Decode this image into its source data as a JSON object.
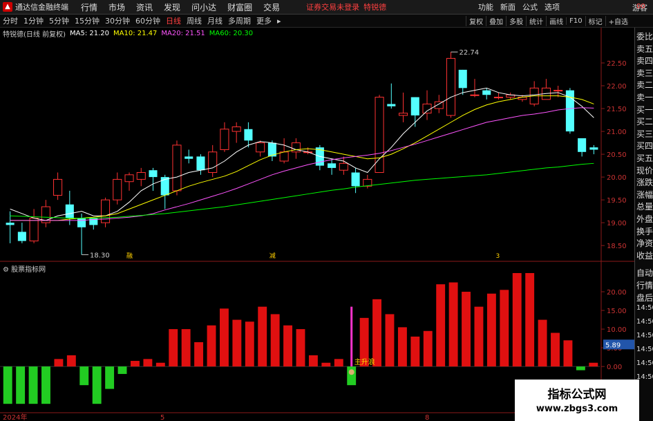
{
  "app": {
    "title": "通达信金融终端",
    "menu": [
      "行情",
      "市场",
      "资讯",
      "发现",
      "问小达",
      "财富圈",
      "交易"
    ],
    "alert": "证券交易未登录",
    "alert2": "特锐德",
    "right_menu": [
      "功能",
      "新面",
      "公式",
      "选项"
    ],
    "guest": "游客"
  },
  "period_tabs": {
    "items": [
      "分时",
      "1分钟",
      "5分钟",
      "15分钟",
      "30分钟",
      "60分钟",
      "日线",
      "周线",
      "月线",
      "多周期",
      "更多"
    ],
    "active_index": 6
  },
  "tools": [
    "复权",
    "叠加",
    "多股",
    "统计",
    "画线",
    "F10",
    "标记",
    "+自选"
  ],
  "legend": {
    "stock": "特锐德(日线 前复权)",
    "ma5": "MA5: 21.20",
    "ma10": "MA10: 21.47",
    "ma20": "MA20: 21.51",
    "ma60": "MA60: 20.30",
    "colors": {
      "ma5": "#ffffff",
      "ma10": "#ffff00",
      "ma20": "#ff55ff",
      "ma60": "#00ff00"
    }
  },
  "side_labels": {
    "top": [
      "委比",
      "卖五",
      "卖四",
      "卖三",
      "卖二",
      "卖一",
      "买一",
      "买二",
      "买三",
      "买四",
      "买五",
      "现价",
      "涨跌",
      "涨幅",
      "总量",
      "外盘",
      "换手",
      "净资",
      "收益"
    ],
    "bottom": [
      "自动",
      "行情",
      "盘后"
    ],
    "times": [
      "14:50",
      "14:50",
      "14:50",
      "14:50",
      "14:50",
      "14:50"
    ],
    "sidebar_num": "00"
  },
  "indicator": {
    "title": "股票指标网",
    "annotation": "主升浪",
    "value_badge": "5.89"
  },
  "chart_data": [
    {
      "type": "candlestick",
      "yticks": [
        "22.50",
        "22.00",
        "21.50",
        "21.00",
        "20.50",
        "20.00",
        "19.50",
        "19.00",
        "18.50"
      ],
      "ylim": [
        18.2,
        23.0
      ],
      "high_label": "22.74",
      "low_label": "18.30",
      "event_markers": [
        "融",
        "减",
        "3"
      ],
      "candles": [
        [
          19.0,
          18.95,
          19.25,
          18.55
        ],
        [
          18.8,
          18.6,
          19.0,
          18.55
        ],
        [
          18.6,
          19.1,
          19.3,
          18.55
        ],
        [
          19.0,
          19.35,
          19.5,
          18.9
        ],
        [
          19.6,
          19.95,
          20.1,
          19.5
        ],
        [
          19.4,
          19.1,
          19.7,
          18.95
        ],
        [
          19.1,
          18.9,
          19.2,
          18.3
        ],
        [
          19.1,
          18.95,
          19.1,
          18.85
        ],
        [
          19.0,
          19.5,
          19.55,
          18.9
        ],
        [
          19.5,
          19.95,
          20.1,
          19.4
        ],
        [
          19.9,
          20.05,
          20.1,
          19.7
        ],
        [
          19.95,
          20.1,
          20.2,
          19.8
        ],
        [
          20.15,
          20.0,
          20.2,
          19.7
        ],
        [
          20.0,
          19.6,
          20.05,
          19.3
        ],
        [
          19.7,
          20.7,
          20.8,
          19.6
        ],
        [
          20.45,
          20.4,
          20.6,
          20.3
        ],
        [
          20.45,
          20.15,
          20.5,
          20.05
        ],
        [
          20.1,
          20.55,
          20.7,
          20.0
        ],
        [
          20.6,
          21.05,
          21.2,
          20.55
        ],
        [
          21.0,
          21.1,
          21.2,
          20.75
        ],
        [
          21.05,
          20.8,
          21.2,
          20.65
        ],
        [
          20.55,
          20.75,
          20.8,
          20.45
        ],
        [
          20.75,
          20.45,
          20.8,
          20.35
        ],
        [
          20.35,
          20.55,
          20.85,
          20.3
        ],
        [
          20.55,
          20.75,
          20.85,
          20.4
        ],
        [
          20.55,
          20.55,
          20.65,
          20.5
        ],
        [
          20.65,
          20.25,
          20.7,
          20.15
        ],
        [
          20.3,
          20.2,
          20.4,
          20.05
        ],
        [
          20.15,
          20.3,
          20.45,
          20.05
        ],
        [
          20.1,
          19.8,
          20.2,
          19.65
        ],
        [
          19.8,
          19.95,
          20.05,
          19.75
        ],
        [
          20.1,
          21.75,
          21.8,
          20.1
        ],
        [
          21.6,
          21.55,
          22.05,
          21.5
        ],
        [
          21.35,
          21.4,
          21.85,
          21.2
        ],
        [
          21.75,
          21.35,
          21.75,
          21.1
        ],
        [
          21.4,
          21.6,
          21.9,
          21.25
        ],
        [
          21.5,
          21.65,
          21.8,
          21.4
        ],
        [
          21.35,
          22.6,
          22.74,
          21.3
        ],
        [
          22.35,
          21.95,
          22.35,
          21.8
        ],
        [
          21.8,
          21.8,
          22.15,
          21.75
        ],
        [
          21.9,
          21.8,
          21.95,
          21.7
        ],
        [
          21.75,
          21.75,
          21.85,
          21.7
        ],
        [
          21.75,
          21.8,
          21.85,
          21.7
        ],
        [
          21.7,
          21.75,
          21.8,
          21.65
        ],
        [
          21.6,
          21.95,
          22.1,
          21.55
        ],
        [
          21.7,
          21.95,
          22.15,
          21.7
        ],
        [
          21.9,
          21.9,
          22.0,
          21.75
        ],
        [
          21.9,
          21.0,
          21.95,
          20.95
        ],
        [
          20.85,
          20.55,
          20.85,
          20.45
        ],
        [
          20.65,
          20.6,
          20.7,
          20.5
        ]
      ],
      "ma": {
        "MA5": [
          19.3,
          19.2,
          19.1,
          19.05,
          19.15,
          19.2,
          19.25,
          19.15,
          19.15,
          19.25,
          19.45,
          19.7,
          19.85,
          19.95,
          20.0,
          20.1,
          20.15,
          20.2,
          20.35,
          20.55,
          20.7,
          20.78,
          20.75,
          20.7,
          20.6,
          20.55,
          20.45,
          20.4,
          20.35,
          20.2,
          20.1,
          20.4,
          20.65,
          20.95,
          21.2,
          21.45,
          21.6,
          21.75,
          21.85,
          21.9,
          21.95,
          21.85,
          21.8,
          21.78,
          21.8,
          21.83,
          21.85,
          21.75,
          21.55,
          21.3
        ],
        "MA10": [
          19.05,
          19.05,
          19.05,
          19.05,
          19.05,
          19.08,
          19.1,
          19.12,
          19.15,
          19.2,
          19.3,
          19.4,
          19.5,
          19.6,
          19.7,
          19.8,
          19.88,
          19.95,
          20.02,
          20.12,
          20.25,
          20.38,
          20.48,
          20.55,
          20.6,
          20.62,
          20.6,
          20.55,
          20.5,
          20.45,
          20.4,
          20.42,
          20.5,
          20.62,
          20.75,
          20.9,
          21.05,
          21.2,
          21.35,
          21.48,
          21.58,
          21.65,
          21.7,
          21.75,
          21.78,
          21.78,
          21.78,
          21.75,
          21.7,
          21.6
        ],
        "MA20": [
          19.05,
          19.05,
          19.05,
          19.05,
          19.05,
          19.05,
          19.05,
          19.07,
          19.08,
          19.1,
          19.12,
          19.15,
          19.2,
          19.28,
          19.35,
          19.42,
          19.5,
          19.58,
          19.66,
          19.75,
          19.85,
          19.95,
          20.05,
          20.13,
          20.2,
          20.27,
          20.33,
          20.38,
          20.42,
          20.45,
          20.48,
          20.52,
          20.58,
          20.65,
          20.72,
          20.8,
          20.88,
          20.96,
          21.04,
          21.12,
          21.2,
          21.25,
          21.3,
          21.35,
          21.38,
          21.42,
          21.47,
          21.5,
          21.52,
          21.51
        ],
        "MA60": [
          19.15,
          19.14,
          19.13,
          19.12,
          19.11,
          19.1,
          19.1,
          19.1,
          19.11,
          19.12,
          19.14,
          19.16,
          19.18,
          19.2,
          19.23,
          19.26,
          19.29,
          19.32,
          19.35,
          19.39,
          19.43,
          19.47,
          19.51,
          19.55,
          19.59,
          19.63,
          19.67,
          19.71,
          19.74,
          19.78,
          19.81,
          19.84,
          19.87,
          19.9,
          19.93,
          19.95,
          19.97,
          19.99,
          20.01,
          20.03,
          20.05,
          20.08,
          20.11,
          20.14,
          20.17,
          20.2,
          20.22,
          20.25,
          20.28,
          20.3
        ]
      }
    },
    {
      "type": "bar",
      "yticks": [
        "20.00",
        "15.00",
        "10.00",
        "5.00",
        "0.00"
      ],
      "ylim": [
        -12,
        25
      ],
      "values": [
        -10,
        -10,
        -10,
        -10,
        2,
        3,
        -5,
        -10,
        -6,
        -2,
        1.5,
        2,
        1,
        10,
        10,
        6.5,
        11,
        15.5,
        12.5,
        12,
        16,
        14,
        11,
        10,
        3,
        1,
        2,
        -5,
        13,
        18,
        14,
        10.5,
        8,
        9.5,
        22,
        22.5,
        20,
        16,
        19.5,
        20.5,
        25,
        25,
        12.5,
        9,
        7,
        -1,
        1
      ]
    }
  ],
  "x_axis": {
    "labels": [
      "2024年",
      "5",
      "8"
    ]
  }
}
